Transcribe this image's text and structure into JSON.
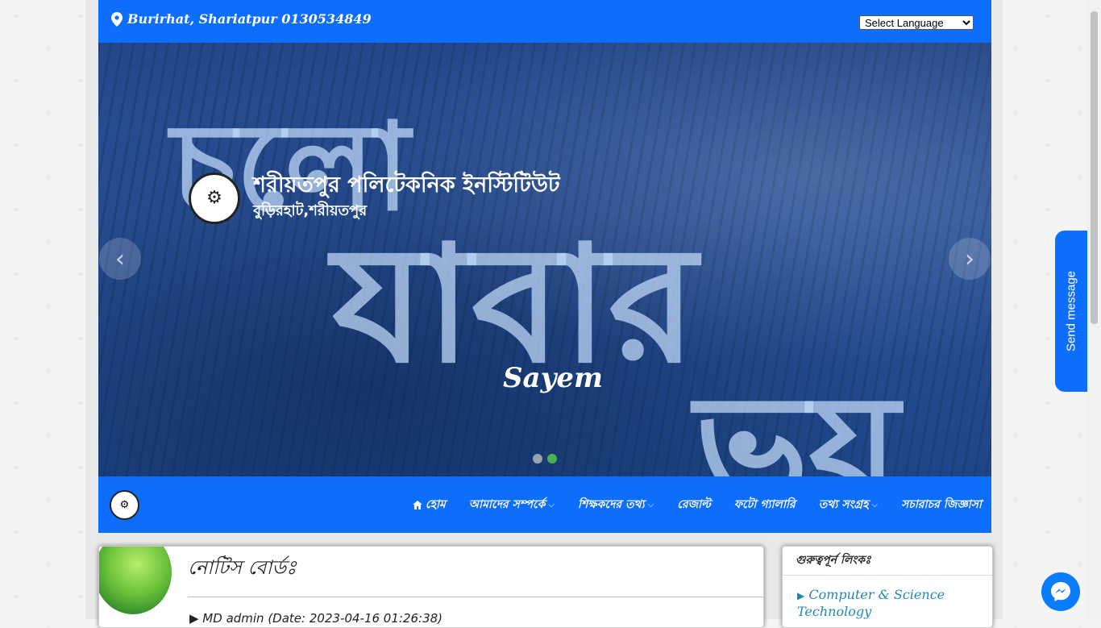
{
  "topbar": {
    "address": "Burirhat, Shariatpur 0130534849",
    "language_select": "Select Language",
    "colors": {
      "brand": "#0d6efd"
    }
  },
  "hero": {
    "bg_text": [
      "চলো",
      "যাবার",
      "ভয়"
    ],
    "institute_name": "শরীয়তপুর পলিটেকনিক ইনস্টিটিউট",
    "institute_location": "বুড়িরহাট,শরীয়তপুর",
    "caption": "Sayem",
    "prev_icon": "‹",
    "next_icon": "›",
    "slides": 2,
    "active_slide": 2
  },
  "nav": {
    "items": [
      {
        "label": "হোম",
        "icon": "home-icon",
        "dropdown": false
      },
      {
        "label": "আমাদের সম্পর্কে",
        "dropdown": true
      },
      {
        "label": "শিক্ষকদের তথ্য",
        "dropdown": true
      },
      {
        "label": "রেজাল্ট",
        "dropdown": false
      },
      {
        "label": "ফটো গ্যালারি",
        "dropdown": false
      },
      {
        "label": "তথ্য সংগ্রহ",
        "dropdown": true
      },
      {
        "label": "সচারাচর জিজ্ঞাসা",
        "dropdown": false
      }
    ]
  },
  "notice": {
    "title": "নোটিস বোর্ডঃ",
    "meta": "▶ MD admin (Date: 2023-04-16 01:26:38)"
  },
  "links": {
    "title": "গুরুত্বপূর্ন লিংকঃ",
    "items": [
      "Computer & Science Technology"
    ]
  },
  "send_message": "Send message"
}
